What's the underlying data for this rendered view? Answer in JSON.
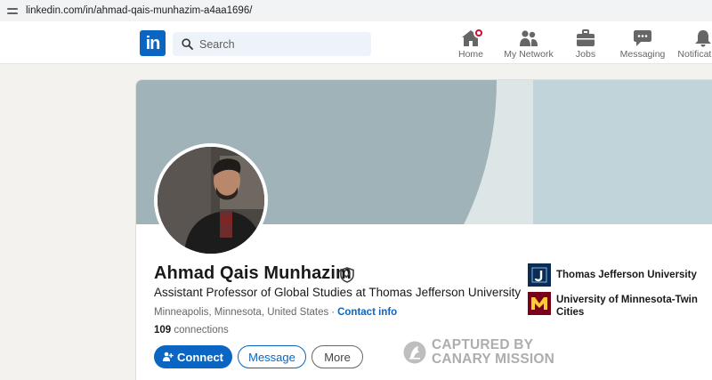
{
  "browser": {
    "url": "linkedin.com/in/ahmad-qais-munhazim-a4aa1696/"
  },
  "nav": {
    "logo_text": "in",
    "search_placeholder": "Search",
    "items": [
      {
        "label": "Home",
        "icon": "home-icon"
      },
      {
        "label": "My Network",
        "icon": "network-icon"
      },
      {
        "label": "Jobs",
        "icon": "briefcase-icon"
      },
      {
        "label": "Messaging",
        "icon": "chat-icon"
      },
      {
        "label": "Notifications",
        "icon": "bell-icon"
      }
    ],
    "notification_dot": "#cb112d"
  },
  "profile": {
    "name": "Ahmad Qais Munhazim",
    "headline": "Assistant Professor of Global Studies at Thomas Jefferson University",
    "location": "Minneapolis, Minnesota, United States",
    "separator": "·",
    "contact_info": "Contact info",
    "connections_count": "109",
    "connections_label": "connections",
    "buttons": {
      "connect": "Connect",
      "message": "Message",
      "more": "More"
    }
  },
  "education": [
    {
      "name": "Thomas Jefferson University",
      "logo": "tju-logo",
      "color": "#0b2c54"
    },
    {
      "name": "University of Minnesota-Twin Cities",
      "logo": "umn-logo",
      "color": "#7a0019"
    }
  ],
  "watermark": {
    "line1": "CAPTURED BY",
    "line2": "CANARY MISSION"
  },
  "colors": {
    "brand": "#0a66c2",
    "page_bg": "#f4f2ee",
    "cover": "#9fb3b8"
  }
}
